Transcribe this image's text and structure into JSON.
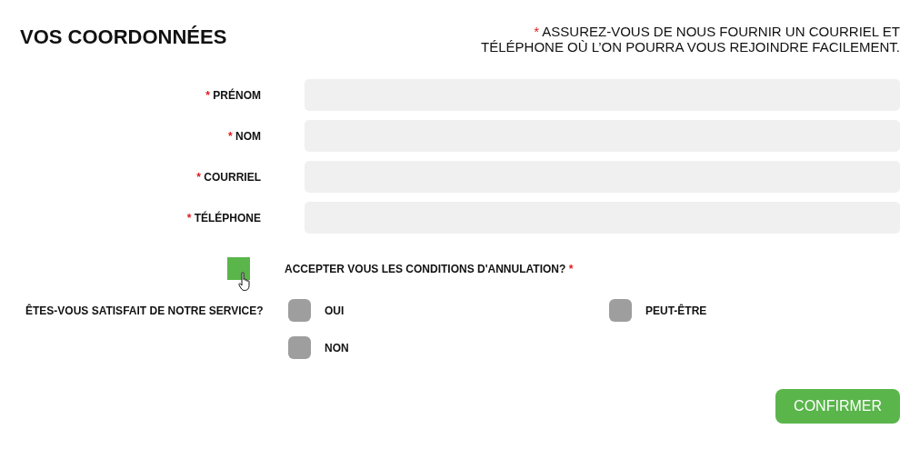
{
  "heading": "VOS COORDONNÉES",
  "note": {
    "mark": "*",
    "lines": [
      "ASSUREZ-VOUS DE NOUS FOURNIR UN COURRIEL ET",
      "TÉLÉPHONE OÙ L’ON POURRA VOUS REJOINDRE FACILEMENT."
    ]
  },
  "fields": [
    {
      "mark": "*",
      "label": "PRÉNOM"
    },
    {
      "mark": "*",
      "label": "NOM"
    },
    {
      "mark": "*",
      "label": "COURRIEL"
    },
    {
      "mark": "*",
      "label": "TÉLÉPHONE"
    }
  ],
  "consent": {
    "label": "ACCEPTER VOUS LES CONDITIONS D'ANNULATION?",
    "mark": "*",
    "checked": true
  },
  "survey": {
    "question": "ÊTES-VOUS SATISFAIT DE NOTRE SERVICE?",
    "options": [
      {
        "label": "OUI",
        "selected": false
      },
      {
        "label": "PEUT-ÊTRE",
        "selected": false
      },
      {
        "label": "NON",
        "selected": false
      }
    ]
  },
  "submit": "CONFIRMER"
}
